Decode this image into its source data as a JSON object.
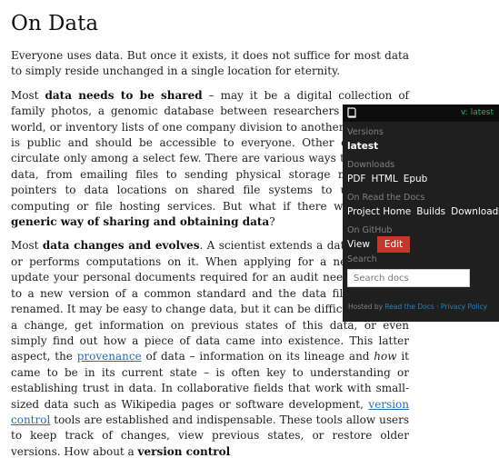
{
  "page": {
    "title": "On Data",
    "p1": "Everyone uses data. But once it exists, it does not suffice for most data to simply reside unchanged in a single location for eternity.",
    "p2_lead": "Most ",
    "p2_bold1": "data needs to be shared",
    "p2_mid": " – may it be a digital collection of family photos, a genomic database between researchers around the world, or inventory lists of one company division to another. Some data is public and should be accessible to everyone. Other data should circulate only among a select few. There are various ways to distribute data, from emailing files to sending physical storage media, from pointers to data locations on shared file systems to using cloud computing or file hosting services. But what if there was an easy, ",
    "p2_bold2": "generic way of sharing and obtaining data",
    "p2_end": "?",
    "p3_lead": "Most ",
    "p3_bold1": "data changes and evolves",
    "p3_a": ". A scientist extends a data collection or performs computations on it. When applying for a new job, you update your personal documents required for an audit need to comply to a new version of a common standard and the data files are thus renamed. It may be easy to change data, but it can be difficult to revert a change, get information on previous states of this data, or even simply find out how a piece of data came into existence. This latter aspect, the ",
    "p3_link1": "provenance",
    "p3_b": " of data – information on its lineage and ",
    "p3_italic": "how",
    "p3_c": " it came to be in its current state – is often key to understanding or establishing trust in data. In collaborative fields that work with small-sized data such as Wikipedia pages or software development, ",
    "p3_link2": "version control",
    "p3_d": " tools are established and indispensable. These tools allow users to keep track of changes, view previous states, or restore older versions. How about a ",
    "p3_bold2": "version control"
  },
  "rtd": {
    "book_icon": "book-icon",
    "version_label": "v: latest",
    "versions_heading": "Versions",
    "current_version": "latest",
    "downloads_heading": "Downloads",
    "downloads": [
      "PDF",
      "HTML",
      "Epub"
    ],
    "rtd_heading": "On Read the Docs",
    "rtd_links": [
      "Project Home",
      "Builds",
      "Downloads"
    ],
    "github_heading": "On GitHub",
    "view_label": "View",
    "edit_label": "Edit",
    "search_heading": "Search",
    "search_placeholder": "Search docs",
    "footer_prefix": "Hosted by ",
    "footer_rtd": "Read the Docs",
    "footer_sep": " · ",
    "footer_privacy": "Privacy Policy"
  },
  "colors": {
    "accent_link": "#2a6cb0",
    "panel_bg": "#1f1f1f",
    "version_green": "#27ae60",
    "edit_red": "#c0392b"
  }
}
